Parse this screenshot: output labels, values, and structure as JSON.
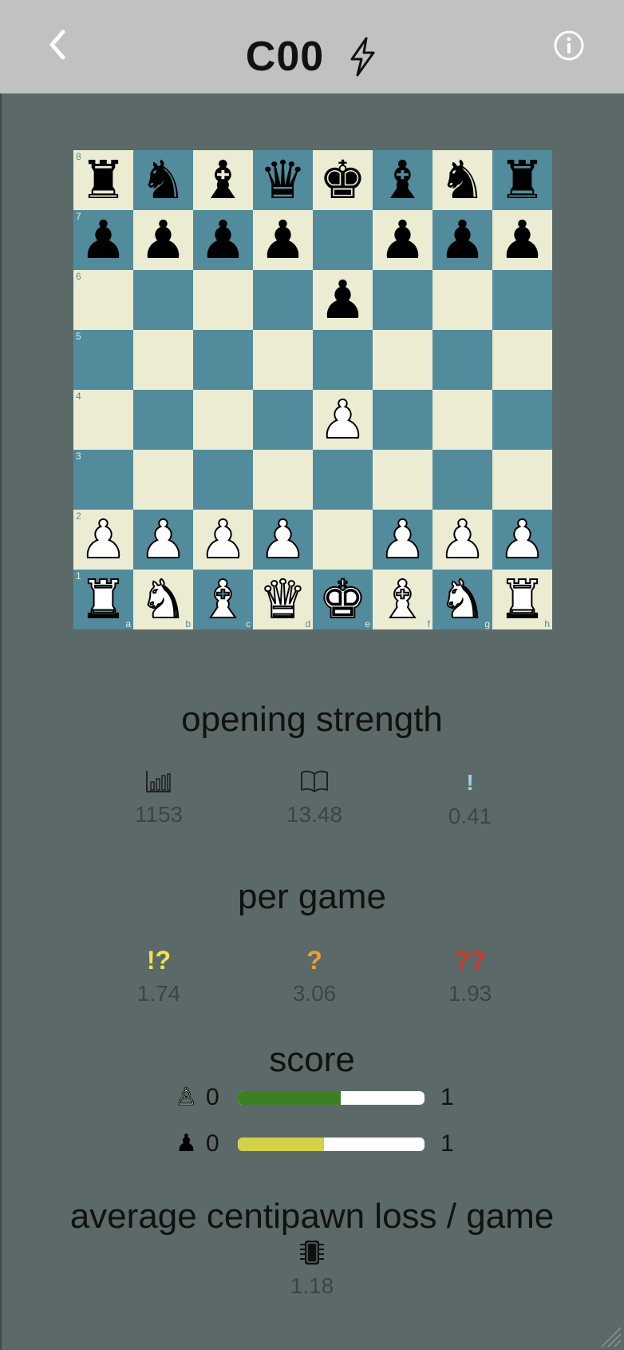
{
  "header": {
    "title": "C00",
    "back_icon": "chevron-left-icon",
    "bolt_icon": "lightning-bolt-icon",
    "info_icon": "info-circle-icon"
  },
  "board": {
    "colors": {
      "light": "#ececd3",
      "dark": "#528b9b"
    },
    "ranks": [
      "8",
      "7",
      "6",
      "5",
      "4",
      "3",
      "2",
      "1"
    ],
    "files": [
      "a",
      "b",
      "c",
      "d",
      "e",
      "f",
      "g",
      "h"
    ],
    "rows": [
      [
        "r",
        "n",
        "b",
        "q",
        "k",
        "b",
        "n",
        "r"
      ],
      [
        "p",
        "p",
        "p",
        "p",
        "",
        "p",
        "p",
        "p"
      ],
      [
        "",
        "",
        "",
        "",
        "p",
        "",
        "",
        ""
      ],
      [
        "",
        "",
        "",
        "",
        "",
        "",
        "",
        ""
      ],
      [
        "",
        "",
        "",
        "",
        "P",
        "",
        "",
        ""
      ],
      [
        "",
        "",
        "",
        "",
        "",
        "",
        "",
        ""
      ],
      [
        "P",
        "P",
        "P",
        "P",
        "",
        "P",
        "P",
        "P"
      ],
      [
        "R",
        "N",
        "B",
        "Q",
        "K",
        "B",
        "N",
        "R"
      ]
    ]
  },
  "opening_strength": {
    "title": "opening strength",
    "stats": [
      {
        "icon": "bar-chart-icon",
        "value": "1153"
      },
      {
        "icon": "book-icon",
        "value": "13.48"
      },
      {
        "icon": "exclamation-icon",
        "symbol": "!",
        "value": "0.41"
      }
    ]
  },
  "per_game": {
    "title": "per game",
    "stats": [
      {
        "symbol": "!?",
        "value": "1.74",
        "color": "#f6e24a"
      },
      {
        "symbol": "?",
        "value": "3.06",
        "color": "#f0a030"
      },
      {
        "symbol": "??",
        "value": "1.93",
        "color": "#d8362a"
      }
    ]
  },
  "score": {
    "title": "score",
    "rows": [
      {
        "icon": "white-pawn-icon",
        "min": "0",
        "max": "1",
        "fraction": 0.55,
        "color": "#3f7f24"
      },
      {
        "icon": "black-pawn-icon",
        "min": "0",
        "max": "1",
        "fraction": 0.46,
        "color": "#d3d04a"
      }
    ]
  },
  "acpl": {
    "title": "average centipawn loss / game",
    "icon": "cpu-chip-icon",
    "value": "1.18"
  }
}
